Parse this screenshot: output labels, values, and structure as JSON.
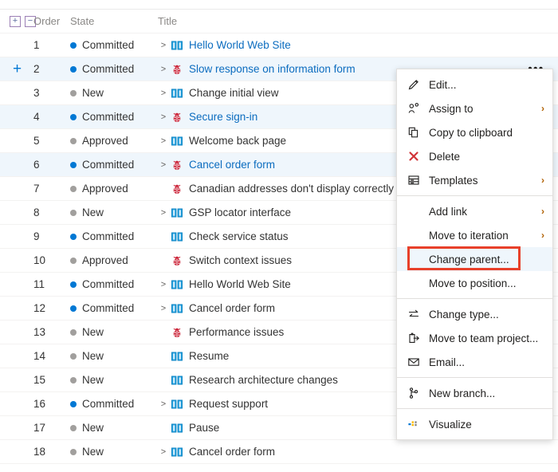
{
  "grid": {
    "header": {
      "expand_all_icon": "plus-box-icon",
      "collapse_all_icon": "minus-box-icon",
      "expand_all_label": "+",
      "collapse_all_label": "−",
      "order_label": "Order",
      "state_label": "State",
      "title_label": "Title"
    },
    "state_colors": {
      "Committed": "#0078d4",
      "New": "#a19f9d",
      "Approved": "#a19f9d"
    },
    "rows": [
      {
        "order": "1",
        "state": "Committed",
        "chevron": ">",
        "type": "story",
        "title": "Hello World Web Site",
        "link": true,
        "actions": false,
        "selected": false,
        "expand": ""
      },
      {
        "order": "2",
        "state": "Committed",
        "chevron": ">",
        "type": "bug",
        "title": "Slow response on information form",
        "link": true,
        "actions": true,
        "selected": true,
        "expand": "+"
      },
      {
        "order": "3",
        "state": "New",
        "chevron": ">",
        "type": "story",
        "title": "Change initial view",
        "link": false,
        "actions": false,
        "selected": false,
        "expand": ""
      },
      {
        "order": "4",
        "state": "Committed",
        "chevron": ">",
        "type": "bug",
        "title": "Secure sign-in",
        "link": true,
        "actions": true,
        "selected": true,
        "expand": ""
      },
      {
        "order": "5",
        "state": "Approved",
        "chevron": ">",
        "type": "story",
        "title": "Welcome back page",
        "link": false,
        "actions": false,
        "selected": false,
        "expand": ""
      },
      {
        "order": "6",
        "state": "Committed",
        "chevron": ">",
        "type": "bug",
        "title": "Cancel order form",
        "link": true,
        "actions": true,
        "selected": true,
        "expand": ""
      },
      {
        "order": "7",
        "state": "Approved",
        "chevron": "",
        "type": "bug",
        "title": "Canadian addresses don't display correctly",
        "link": false,
        "actions": false,
        "selected": false,
        "expand": ""
      },
      {
        "order": "8",
        "state": "New",
        "chevron": ">",
        "type": "story",
        "title": "GSP locator interface",
        "link": false,
        "actions": false,
        "selected": false,
        "expand": ""
      },
      {
        "order": "9",
        "state": "Committed",
        "chevron": "",
        "type": "story",
        "title": "Check service status",
        "link": false,
        "actions": false,
        "selected": false,
        "expand": ""
      },
      {
        "order": "10",
        "state": "Approved",
        "chevron": "",
        "type": "bug",
        "title": "Switch context issues",
        "link": false,
        "actions": false,
        "selected": false,
        "expand": ""
      },
      {
        "order": "11",
        "state": "Committed",
        "chevron": ">",
        "type": "story",
        "title": "Hello World Web Site",
        "link": false,
        "actions": false,
        "selected": false,
        "expand": ""
      },
      {
        "order": "12",
        "state": "Committed",
        "chevron": ">",
        "type": "story",
        "title": "Cancel order form",
        "link": false,
        "actions": false,
        "selected": false,
        "expand": ""
      },
      {
        "order": "13",
        "state": "New",
        "chevron": "",
        "type": "bug",
        "title": "Performance issues",
        "link": false,
        "actions": false,
        "selected": false,
        "expand": ""
      },
      {
        "order": "14",
        "state": "New",
        "chevron": "",
        "type": "story",
        "title": "Resume",
        "link": false,
        "actions": false,
        "selected": false,
        "expand": ""
      },
      {
        "order": "15",
        "state": "New",
        "chevron": "",
        "type": "story",
        "title": "Research architecture changes",
        "link": false,
        "actions": false,
        "selected": false,
        "expand": ""
      },
      {
        "order": "16",
        "state": "Committed",
        "chevron": ">",
        "type": "story",
        "title": "Request support",
        "link": false,
        "actions": false,
        "selected": false,
        "expand": ""
      },
      {
        "order": "17",
        "state": "New",
        "chevron": "",
        "type": "story",
        "title": "Pause",
        "link": false,
        "actions": false,
        "selected": false,
        "expand": ""
      },
      {
        "order": "18",
        "state": "New",
        "chevron": ">",
        "type": "story",
        "title": "Cancel order form",
        "link": false,
        "actions": false,
        "selected": false,
        "expand": ""
      }
    ],
    "actions_glyph": "•••"
  },
  "context_menu": {
    "highlight_color": "#e8402a",
    "items": [
      {
        "kind": "item",
        "icon": "pencil-icon",
        "label": "Edit...",
        "submenu": "",
        "highlighted": false
      },
      {
        "kind": "item",
        "icon": "assign-person-icon",
        "label": "Assign to",
        "submenu": "›",
        "highlighted": false
      },
      {
        "kind": "item",
        "icon": "copy-icon",
        "label": "Copy to clipboard",
        "submenu": "",
        "highlighted": false
      },
      {
        "kind": "item",
        "icon": "delete-x-icon",
        "label": "Delete",
        "submenu": "",
        "highlighted": false
      },
      {
        "kind": "item",
        "icon": "templates-icon",
        "label": "Templates",
        "submenu": "›",
        "highlighted": false
      },
      {
        "kind": "divider"
      },
      {
        "kind": "item",
        "icon": "",
        "label": "Add link",
        "submenu": "›",
        "highlighted": false
      },
      {
        "kind": "item",
        "icon": "",
        "label": "Move to iteration",
        "submenu": "›",
        "highlighted": false
      },
      {
        "kind": "item",
        "icon": "",
        "label": "Change parent...",
        "submenu": "",
        "highlighted": true
      },
      {
        "kind": "item",
        "icon": "",
        "label": "Move to position...",
        "submenu": "",
        "highlighted": false
      },
      {
        "kind": "divider"
      },
      {
        "kind": "item",
        "icon": "change-type-icon",
        "label": "Change type...",
        "submenu": "",
        "highlighted": false
      },
      {
        "kind": "item",
        "icon": "move-project-icon",
        "label": "Move to team project...",
        "submenu": "",
        "highlighted": false
      },
      {
        "kind": "item",
        "icon": "email-icon",
        "label": "Email...",
        "submenu": "",
        "highlighted": false
      },
      {
        "kind": "divider"
      },
      {
        "kind": "item",
        "icon": "branch-icon",
        "label": "New branch...",
        "submenu": "",
        "highlighted": false
      },
      {
        "kind": "divider"
      },
      {
        "kind": "item",
        "icon": "visualize-icon",
        "label": "Visualize",
        "submenu": "",
        "highlighted": false
      }
    ]
  }
}
